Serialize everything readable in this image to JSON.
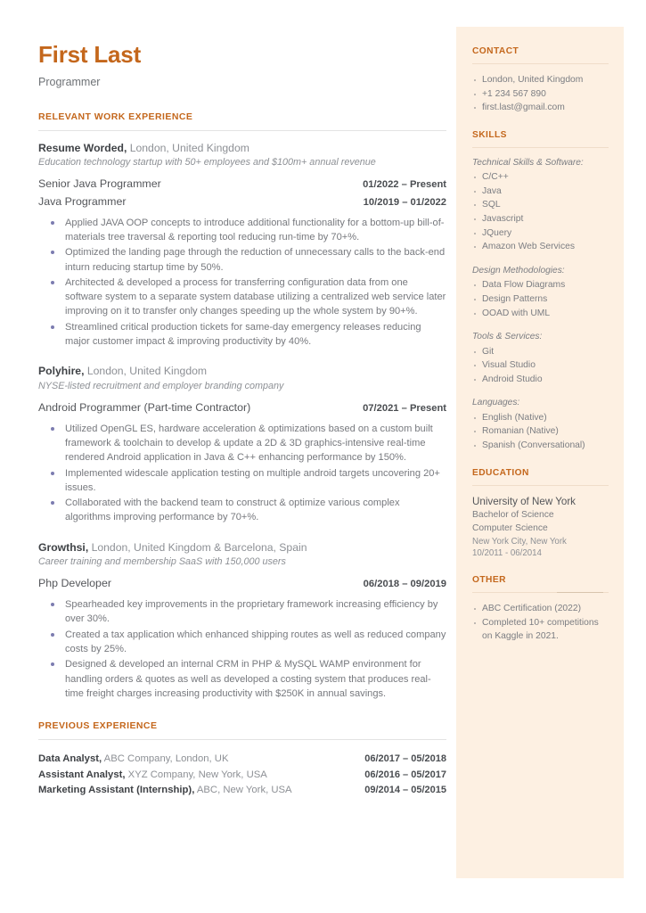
{
  "header": {
    "name": "First Last",
    "role": "Programmer"
  },
  "sections": {
    "relevant_experience_heading": "RELEVANT WORK EXPERIENCE",
    "previous_experience_heading": "PREVIOUS EXPERIENCE"
  },
  "jobs": [
    {
      "company": "Resume Worded,",
      "location": " London, United Kingdom",
      "description": "Education technology startup with 50+ employees and $100m+ annual revenue",
      "positions": [
        {
          "title": "Senior Java Programmer",
          "date": "01/2022 – Present"
        },
        {
          "title": "Java Programmer",
          "date": "10/2019 – 01/2022"
        }
      ],
      "bullets": [
        "Applied JAVA OOP concepts to introduce additional functionality for a bottom-up bill-of-materials tree traversal & reporting tool reducing run-time by 70+%.",
        "Optimized the landing page through the reduction of unnecessary calls to the back-end inturn reducing startup time by 50%.",
        "Architected & developed a process for transferring configuration data from one software system to a separate system database utilizing a centralized web service later improving on it to transfer only changes speeding up the whole system by 90+%.",
        "Streamlined critical production tickets for same-day emergency releases reducing major customer impact & improving productivity by 40%."
      ]
    },
    {
      "company": "Polyhire,",
      "location": " London, United Kingdom",
      "description": "NYSE-listed recruitment and employer branding company",
      "positions": [
        {
          "title": "Android Programmer (Part-time Contractor)",
          "date": "07/2021 – Present"
        }
      ],
      "bullets": [
        "Utilized OpenGL ES, hardware acceleration & optimizations based on a custom built framework & toolchain to develop & update a 2D & 3D graphics-intensive real-time rendered Android application in Java & C++ enhancing performance by 150%.",
        "Implemented widescale application testing on multiple android targets uncovering 20+ issues.",
        "Collaborated with the backend team to construct & optimize various complex algorithms improving performance by 70+%."
      ]
    },
    {
      "company": "Growthsi,",
      "location": " London, United Kingdom & Barcelona, Spain",
      "description": "Career training and membership SaaS with 150,000 users",
      "positions": [
        {
          "title": "Php Developer",
          "date": "06/2018 – 09/2019"
        }
      ],
      "bullets": [
        "Spearheaded key improvements in the proprietary framework increasing efficiency by over 30%.",
        "Created a tax application which enhanced shipping routes as well as reduced company costs by 25%.",
        "Designed & developed an internal CRM in PHP & MySQL WAMP environment for handling orders & quotes as well as developed a costing system that produces real-time freight charges increasing productivity with $250K in annual savings."
      ]
    }
  ],
  "previous_experience": [
    {
      "title": "Data Analyst,",
      "detail": " ABC Company, London, UK",
      "date": "06/2017 – 05/2018"
    },
    {
      "title": "Assistant Analyst,",
      "detail": " XYZ Company, New York, USA",
      "date": "06/2016 – 05/2017"
    },
    {
      "title": "Marketing Assistant (Internship),",
      "detail": " ABC, New York, USA",
      "date": "09/2014 – 05/2015"
    }
  ],
  "sidebar": {
    "contact": {
      "heading": "CONTACT",
      "items": [
        "London, United Kingdom",
        "+1 234 567 890",
        "first.last@gmail.com"
      ]
    },
    "skills": {
      "heading": "SKILLS",
      "groups": [
        {
          "category": "Technical Skills & Software:",
          "items": [
            "C/C++",
            "Java",
            "SQL",
            "Javascript",
            "JQuery",
            "Amazon Web Services"
          ]
        },
        {
          "category": "Design Methodologies:",
          "items": [
            "Data Flow Diagrams",
            "Design Patterns",
            "OOAD with UML"
          ]
        },
        {
          "category": "Tools & Services:",
          "items": [
            "Git",
            "Visual Studio",
            "Android Studio"
          ]
        },
        {
          "category": "Languages:",
          "items": [
            "English (Native)",
            "Romanian (Native)",
            "Spanish (Conversational)"
          ]
        }
      ]
    },
    "education": {
      "heading": "EDUCATION",
      "school": "University of New York",
      "degree": "Bachelor of Science",
      "field": "Computer Science",
      "location": "New York City, New York",
      "dates": "10/2011 - 06/2014"
    },
    "other": {
      "heading": "OTHER",
      "items": [
        "ABC Certification (2022)",
        "Completed 10+ competitions on Kaggle in 2021."
      ]
    }
  },
  "colors": {
    "accent": "#c4671c",
    "sidebar_bg": "#fdf0e2",
    "bullet": "#7c7cb0",
    "body_text": "#77797e"
  }
}
